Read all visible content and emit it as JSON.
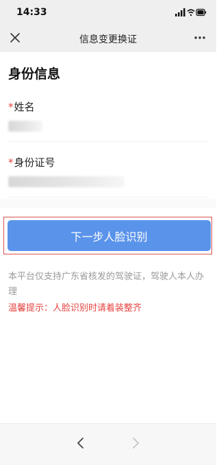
{
  "status": {
    "time": "14:33"
  },
  "nav": {
    "title": "信息变更换证"
  },
  "section": {
    "title": "身份信息"
  },
  "form": {
    "name": {
      "required_mark": "*",
      "label": "姓名"
    },
    "id_number": {
      "required_mark": "*",
      "label": "身份证号"
    }
  },
  "action": {
    "next_label": "下一步人脸识别"
  },
  "notice": {
    "text": "本平台仅支持广东省核发的驾驶证，驾驶人本人办理",
    "tip": "温馨提示：人脸识别时请着装整齐"
  },
  "colors": {
    "primary": "#5a93ea",
    "warning": "#e64340",
    "muted": "#9a9a9a",
    "bar_bg": "#efefef"
  },
  "icons": {
    "close": "close-icon",
    "more": "more-dots-icon",
    "back": "chevron-left-icon",
    "forward": "chevron-right-icon",
    "signal": "signal-icon",
    "wifi": "wifi-icon",
    "battery": "battery-icon"
  }
}
